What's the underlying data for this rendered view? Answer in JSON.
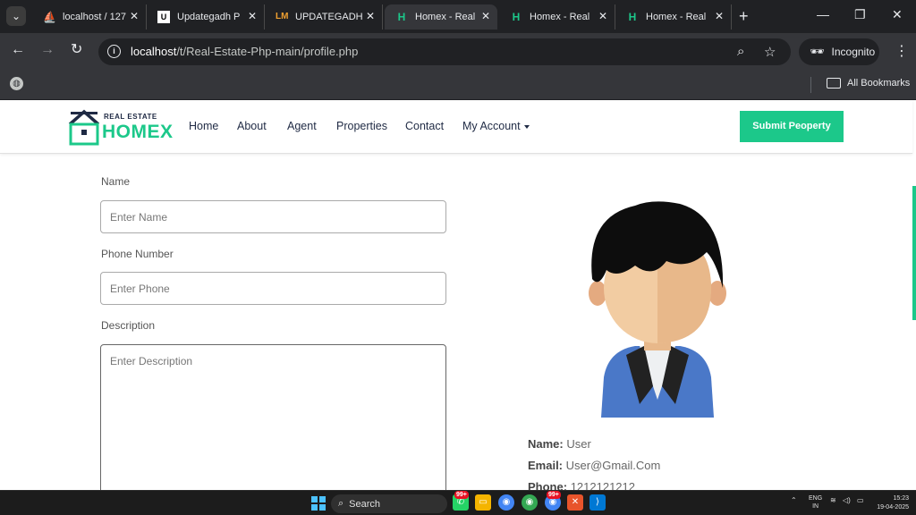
{
  "browser": {
    "tabs": [
      {
        "title": "localhost / 127",
        "favicon": "phpmyadmin-icon"
      },
      {
        "title": "Updategadh P",
        "favicon": "updategadh-icon"
      },
      {
        "title": "UPDATEGADH",
        "favicon": "updategadh-lm-icon"
      },
      {
        "title": "Homex - Real",
        "favicon": "homex-h-icon"
      },
      {
        "title": "Homex - Real",
        "favicon": "homex-h-icon"
      },
      {
        "title": "Homex - Real",
        "favicon": "homex-h-icon"
      }
    ],
    "active_tab_index": 3,
    "url_host": "localhost",
    "url_path": "/t/Real-Estate-Php-main/profile.php",
    "incognito_label": "Incognito",
    "bookmarks_label": "All Bookmarks"
  },
  "site": {
    "logo_top": "REAL ESTATE",
    "logo_main": "HOMEX",
    "nav": [
      "Home",
      "About",
      "Agent",
      "Properties",
      "Contact",
      "My Account"
    ],
    "submit_button": "Submit Peoperty",
    "accent_color": "#1cc88a"
  },
  "form": {
    "name_label": "Name",
    "name_placeholder": "Enter Name",
    "phone_label": "Phone Number",
    "phone_placeholder": "Enter Phone",
    "description_label": "Description",
    "description_placeholder": "Enter Description"
  },
  "profile": {
    "name_key": "Name:",
    "name_value": "User",
    "email_key": "Email:",
    "email_value": "User@Gmail.Com",
    "phone_key": "Phone:",
    "phone_value": "1212121212"
  },
  "taskbar": {
    "search_label": "Search",
    "badges": [
      "99+",
      "99+"
    ],
    "lang_top": "ENG",
    "lang_bottom": "IN",
    "time": "15:23",
    "date": "19-04-2025"
  }
}
